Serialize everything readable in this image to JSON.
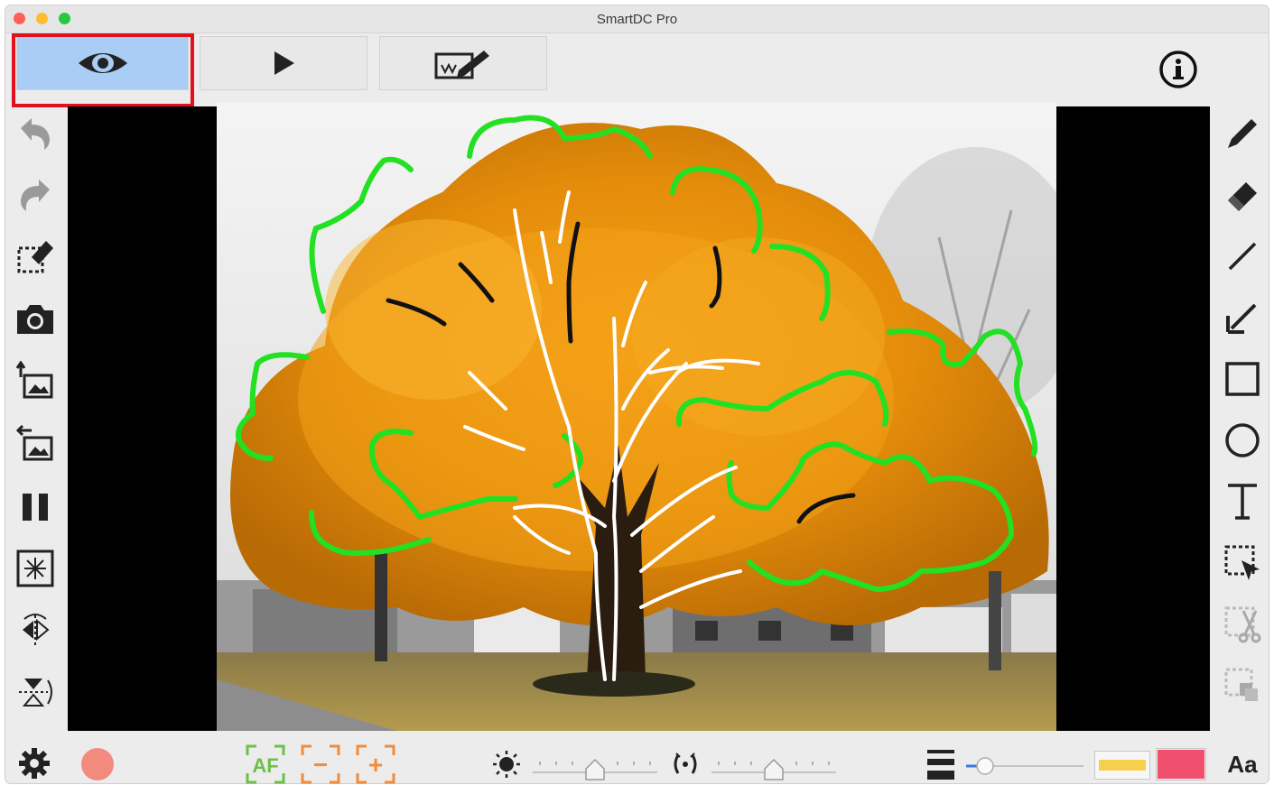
{
  "window": {
    "title": "SmartDC Pro",
    "traffic_lights": [
      {
        "name": "close",
        "color": "#fe5f57"
      },
      {
        "name": "minimize",
        "color": "#febc2e"
      },
      {
        "name": "zoom",
        "color": "#28c840"
      }
    ]
  },
  "toolbar": {
    "modes": [
      {
        "name": "view",
        "icon": "eye-icon",
        "active": true
      },
      {
        "name": "play",
        "icon": "play-icon",
        "active": false
      },
      {
        "name": "annotate",
        "icon": "whiteboard-pen-icon",
        "active": false
      }
    ],
    "info_icon": "info-icon",
    "highlight_color": "#e0101c",
    "active_color": "#a9cdf5"
  },
  "left_tools": [
    {
      "name": "undo",
      "icon": "undo-icon"
    },
    {
      "name": "redo",
      "icon": "redo-icon"
    },
    {
      "name": "clear-annotations",
      "icon": "clear-selection-icon"
    },
    {
      "name": "capture",
      "icon": "camera-icon"
    },
    {
      "name": "import-image",
      "icon": "import-image-icon"
    },
    {
      "name": "export-image",
      "icon": "export-image-icon"
    },
    {
      "name": "pause",
      "icon": "pause-icon"
    },
    {
      "name": "freeze-frame",
      "icon": "freeze-icon"
    },
    {
      "name": "flip-horizontal",
      "icon": "flip-horizontal-icon"
    },
    {
      "name": "flip-vertical",
      "icon": "flip-vertical-icon"
    }
  ],
  "right_tools": [
    {
      "name": "pen",
      "icon": "pen-icon",
      "enabled": true
    },
    {
      "name": "eraser",
      "icon": "eraser-icon",
      "enabled": true
    },
    {
      "name": "line",
      "icon": "line-icon",
      "enabled": true
    },
    {
      "name": "arrow",
      "icon": "arrow-icon",
      "enabled": true
    },
    {
      "name": "rectangle",
      "icon": "rectangle-icon",
      "enabled": true
    },
    {
      "name": "circle",
      "icon": "circle-icon",
      "enabled": true
    },
    {
      "name": "text",
      "icon": "text-icon",
      "enabled": true
    },
    {
      "name": "select",
      "icon": "select-icon",
      "enabled": true
    },
    {
      "name": "cut",
      "icon": "cut-icon",
      "enabled": false
    },
    {
      "name": "paste",
      "icon": "paste-icon",
      "enabled": false
    }
  ],
  "bottom_bar": {
    "settings_icon": "gear-icon",
    "record_color": "#f28b7d",
    "focus": {
      "autofocus_label": "AF",
      "focus_minus_label": "−",
      "focus_plus_label": "+",
      "color": "#6cc04a"
    },
    "brightness": {
      "icon": "brightness-icon",
      "level": 0.5
    },
    "contrast": {
      "icon": "contrast-icon",
      "level": 0.5
    },
    "line_width": {
      "icon": "line-width-icon",
      "level": 0.1,
      "color": "#3a7bd5"
    },
    "highlighter_color": "#f6d04d",
    "pen_color": "#f0506e",
    "font_label": "Aa"
  },
  "stage": {
    "annotation_colors": [
      "#22e022",
      "#ffffff",
      "#111111"
    ]
  }
}
